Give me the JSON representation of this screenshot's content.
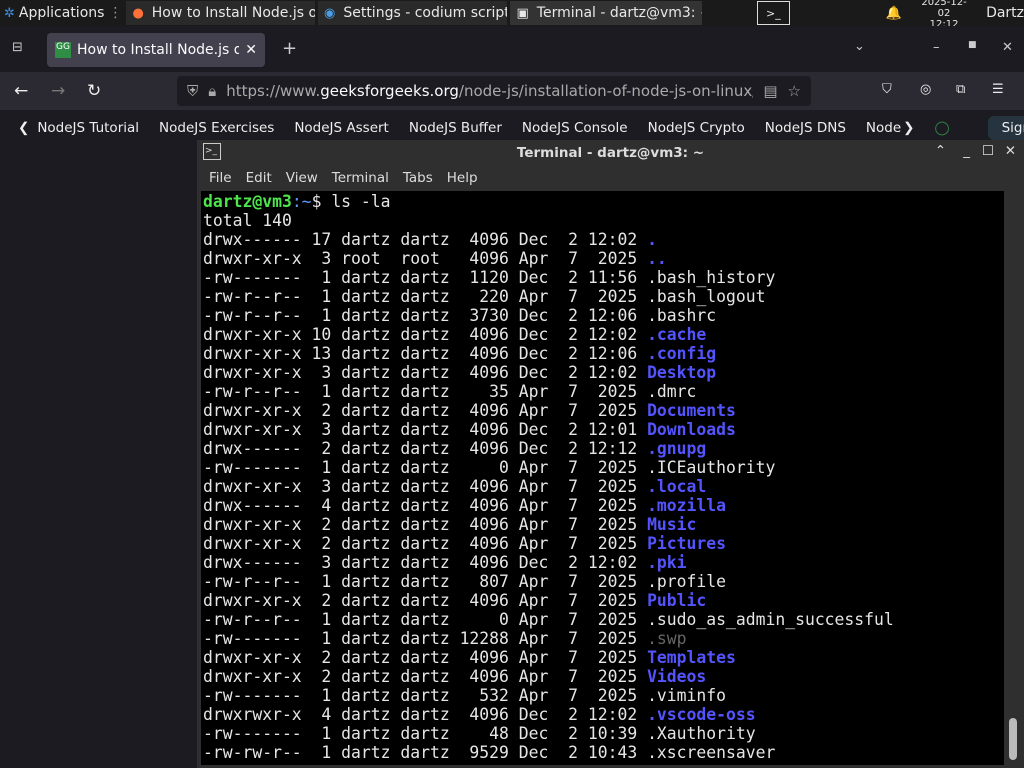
{
  "taskbar": {
    "apps_label": "Applications",
    "windows": [
      {
        "title": "How to Install Node.js o...",
        "icon": "firefox-icon"
      },
      {
        "title": "Settings - codium script...",
        "icon": "codium-icon"
      },
      {
        "title": "Terminal - dartz@vm3: ~",
        "icon": "terminal-icon"
      }
    ],
    "date": "2025-12-02",
    "time": "12:12",
    "user": "Dartz"
  },
  "browser": {
    "tab_title": "How to Install Node.js or",
    "url_prefix": "https://www.",
    "url_domain": "geeksforgeeks.org",
    "url_path": "/node-js/installation-of-node-js-on-linux/",
    "nav_items": [
      "NodeJS Tutorial",
      "NodeJS Exercises",
      "NodeJS Assert",
      "NodeJS Buffer",
      "NodeJS Console",
      "NodeJS Crypto",
      "NodeJS DNS",
      "Node"
    ],
    "sign_in": "Sign In"
  },
  "terminal": {
    "title": "Terminal - dartz@vm3: ~",
    "menu": [
      "File",
      "Edit",
      "View",
      "Terminal",
      "Tabs",
      "Help"
    ],
    "prompt_user": "dartz@vm3",
    "prompt_path": ":~",
    "prompt_symbol": "$ ",
    "command": "ls -la",
    "total": "total 140",
    "rows": [
      {
        "meta": "drwx------ 17 dartz dartz  4096 Dec  2 12:02 ",
        "name": ".",
        "type": "dir"
      },
      {
        "meta": "drwxr-xr-x  3 root  root   4096 Apr  7  2025 ",
        "name": "..",
        "type": "dir"
      },
      {
        "meta": "-rw-------  1 dartz dartz  1120 Dec  2 11:56 ",
        "name": ".bash_history",
        "type": "file"
      },
      {
        "meta": "-rw-r--r--  1 dartz dartz   220 Apr  7  2025 ",
        "name": ".bash_logout",
        "type": "file"
      },
      {
        "meta": "-rw-r--r--  1 dartz dartz  3730 Dec  2 12:06 ",
        "name": ".bashrc",
        "type": "file"
      },
      {
        "meta": "drwxr-xr-x 10 dartz dartz  4096 Dec  2 12:02 ",
        "name": ".cache",
        "type": "dir"
      },
      {
        "meta": "drwxr-xr-x 13 dartz dartz  4096 Dec  2 12:06 ",
        "name": ".config",
        "type": "dir"
      },
      {
        "meta": "drwxr-xr-x  3 dartz dartz  4096 Dec  2 12:02 ",
        "name": "Desktop",
        "type": "dir"
      },
      {
        "meta": "-rw-r--r--  1 dartz dartz    35 Apr  7  2025 ",
        "name": ".dmrc",
        "type": "file"
      },
      {
        "meta": "drwxr-xr-x  2 dartz dartz  4096 Apr  7  2025 ",
        "name": "Documents",
        "type": "dir"
      },
      {
        "meta": "drwxr-xr-x  3 dartz dartz  4096 Dec  2 12:01 ",
        "name": "Downloads",
        "type": "dir"
      },
      {
        "meta": "drwx------  2 dartz dartz  4096 Dec  2 12:12 ",
        "name": ".gnupg",
        "type": "dir"
      },
      {
        "meta": "-rw-------  1 dartz dartz     0 Apr  7  2025 ",
        "name": ".ICEauthority",
        "type": "file"
      },
      {
        "meta": "drwxr-xr-x  3 dartz dartz  4096 Apr  7  2025 ",
        "name": ".local",
        "type": "dir"
      },
      {
        "meta": "drwx------  4 dartz dartz  4096 Apr  7  2025 ",
        "name": ".mozilla",
        "type": "dir"
      },
      {
        "meta": "drwxr-xr-x  2 dartz dartz  4096 Apr  7  2025 ",
        "name": "Music",
        "type": "dir"
      },
      {
        "meta": "drwxr-xr-x  2 dartz dartz  4096 Apr  7  2025 ",
        "name": "Pictures",
        "type": "dir"
      },
      {
        "meta": "drwx------  3 dartz dartz  4096 Dec  2 12:02 ",
        "name": ".pki",
        "type": "dir"
      },
      {
        "meta": "-rw-r--r--  1 dartz dartz   807 Apr  7  2025 ",
        "name": ".profile",
        "type": "file"
      },
      {
        "meta": "drwxr-xr-x  2 dartz dartz  4096 Apr  7  2025 ",
        "name": "Public",
        "type": "dir"
      },
      {
        "meta": "-rw-r--r--  1 dartz dartz     0 Apr  7  2025 ",
        "name": ".sudo_as_admin_successful",
        "type": "file"
      },
      {
        "meta": "-rw-------  1 dartz dartz 12288 Apr  7  2025 ",
        "name": ".swp",
        "type": "gray"
      },
      {
        "meta": "drwxr-xr-x  2 dartz dartz  4096 Apr  7  2025 ",
        "name": "Templates",
        "type": "dir"
      },
      {
        "meta": "drwxr-xr-x  2 dartz dartz  4096 Apr  7  2025 ",
        "name": "Videos",
        "type": "dir"
      },
      {
        "meta": "-rw-------  1 dartz dartz   532 Apr  7  2025 ",
        "name": ".viminfo",
        "type": "file"
      },
      {
        "meta": "drwxrwxr-x  4 dartz dartz  4096 Dec  2 12:02 ",
        "name": ".vscode-oss",
        "type": "dir"
      },
      {
        "meta": "-rw-------  1 dartz dartz    48 Dec  2 10:39 ",
        "name": ".Xauthority",
        "type": "file"
      },
      {
        "meta": "-rw-rw-r--  1 dartz dartz  9529 Dec  2 10:43 ",
        "name": ".xscreensaver",
        "type": "file"
      }
    ]
  },
  "colors": {
    "prompt_green": "#4ee44e",
    "directory_blue": "#5454ff",
    "terminal_bg": "#000000"
  }
}
